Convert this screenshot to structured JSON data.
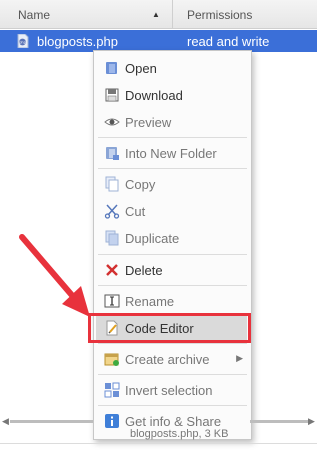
{
  "header": {
    "col_name": "Name",
    "col_perm": "Permissions",
    "sort_icon": "triangle-up"
  },
  "file_row": {
    "name": "blogposts.php",
    "permissions": "read and write"
  },
  "context_menu": {
    "items": [
      {
        "label": "Open",
        "icon": "folder-open-icon"
      },
      {
        "label": "Download",
        "icon": "download-icon"
      },
      {
        "label": "Preview",
        "icon": "eye-icon"
      },
      {
        "label": "Into New Folder",
        "icon": "new-folder-icon"
      },
      {
        "label": "Copy",
        "icon": "copy-icon"
      },
      {
        "label": "Cut",
        "icon": "scissors-icon"
      },
      {
        "label": "Duplicate",
        "icon": "duplicate-icon"
      },
      {
        "label": "Delete",
        "icon": "delete-x-icon"
      },
      {
        "label": "Rename",
        "icon": "rename-icon"
      },
      {
        "label": "Code Editor",
        "icon": "code-editor-icon"
      },
      {
        "label": "Create archive",
        "icon": "archive-icon"
      },
      {
        "label": "Invert selection",
        "icon": "invert-selection-icon"
      },
      {
        "label": "Get info & Share",
        "icon": "info-icon"
      }
    ]
  },
  "status_text": "blogposts.php, 3 KB",
  "colors": {
    "selection": "#3b6fd8",
    "highlight_border": "#e8323c",
    "arrow": "#e8323c"
  }
}
